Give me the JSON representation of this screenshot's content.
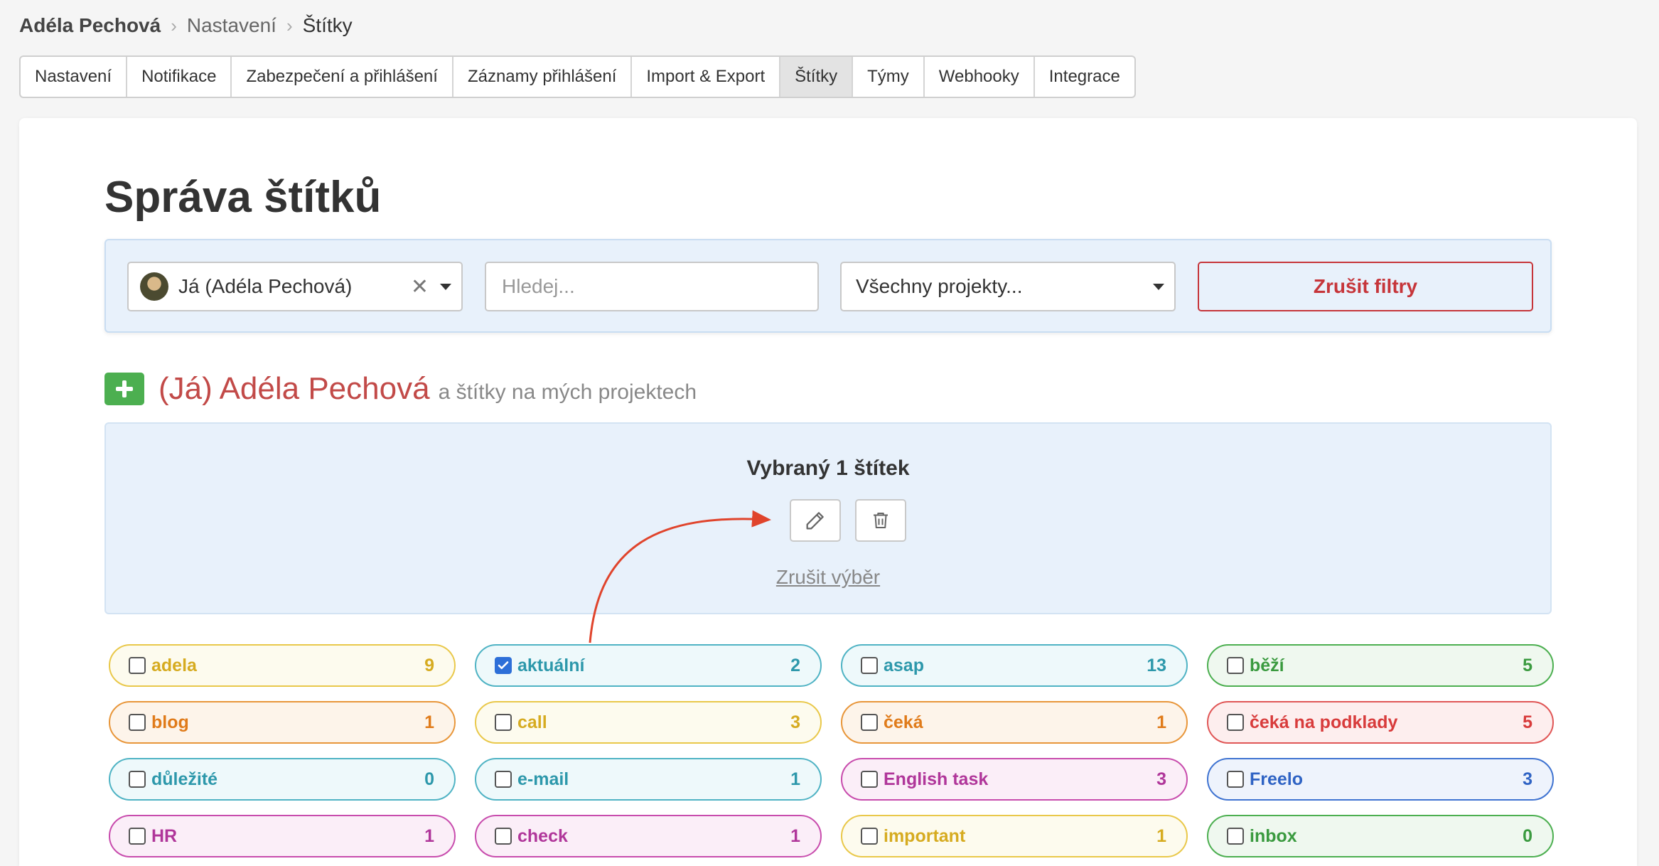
{
  "breadcrumb": {
    "user": "Adéla Pechová",
    "settings": "Nastavení",
    "current": "Štítky"
  },
  "tabs": [
    {
      "label": "Nastavení"
    },
    {
      "label": "Notifikace"
    },
    {
      "label": "Zabezpečení a přihlášení"
    },
    {
      "label": "Záznamy přihlášení"
    },
    {
      "label": "Import & Export"
    },
    {
      "label": "Štítky",
      "active": true
    },
    {
      "label": "Týmy"
    },
    {
      "label": "Webhooky"
    },
    {
      "label": "Integrace"
    }
  ],
  "page": {
    "title": "Správa štítků"
  },
  "filters": {
    "user_value": "Já (Adéla Pechová)",
    "clear_symbol": "✕",
    "search_placeholder": "Hledej...",
    "project_value": "Všechny projekty...",
    "reset_label": "Zrušit filtry"
  },
  "section": {
    "owner": "(Já) Adéla Pechová",
    "subtitle": "a štítky na mých projektech"
  },
  "selection": {
    "title": "Vybraný 1 štítek",
    "cancel_label": "Zrušit výběr"
  },
  "colors": {
    "accent_red": "#c6353a",
    "add_green": "#4caf50",
    "annotation_arrow": "#e0442c",
    "checkbox_blue": "#2d6fd8"
  },
  "tags": [
    {
      "name": "adela",
      "count": "9",
      "color": "yellow",
      "checked": false
    },
    {
      "name": "aktuální",
      "count": "2",
      "color": "teal",
      "checked": true
    },
    {
      "name": "asap",
      "count": "13",
      "color": "teal",
      "checked": false
    },
    {
      "name": "běží",
      "count": "5",
      "color": "green",
      "checked": false
    },
    {
      "name": "blog",
      "count": "1",
      "color": "orange",
      "checked": false
    },
    {
      "name": "call",
      "count": "3",
      "color": "yellow",
      "checked": false
    },
    {
      "name": "čeká",
      "count": "1",
      "color": "orange",
      "checked": false
    },
    {
      "name": "čeká na podklady",
      "count": "5",
      "color": "red",
      "checked": false
    },
    {
      "name": "důležité",
      "count": "0",
      "color": "teal",
      "checked": false
    },
    {
      "name": "e-mail",
      "count": "1",
      "color": "teal",
      "checked": false
    },
    {
      "name": "English task",
      "count": "3",
      "color": "pink",
      "checked": false
    },
    {
      "name": "Freelo",
      "count": "3",
      "color": "blue",
      "checked": false
    },
    {
      "name": "HR",
      "count": "1",
      "color": "pink",
      "checked": false
    },
    {
      "name": "check",
      "count": "1",
      "color": "pink",
      "checked": false
    },
    {
      "name": "important",
      "count": "1",
      "color": "yellow",
      "checked": false
    },
    {
      "name": "inbox",
      "count": "0",
      "color": "green",
      "checked": false
    }
  ]
}
